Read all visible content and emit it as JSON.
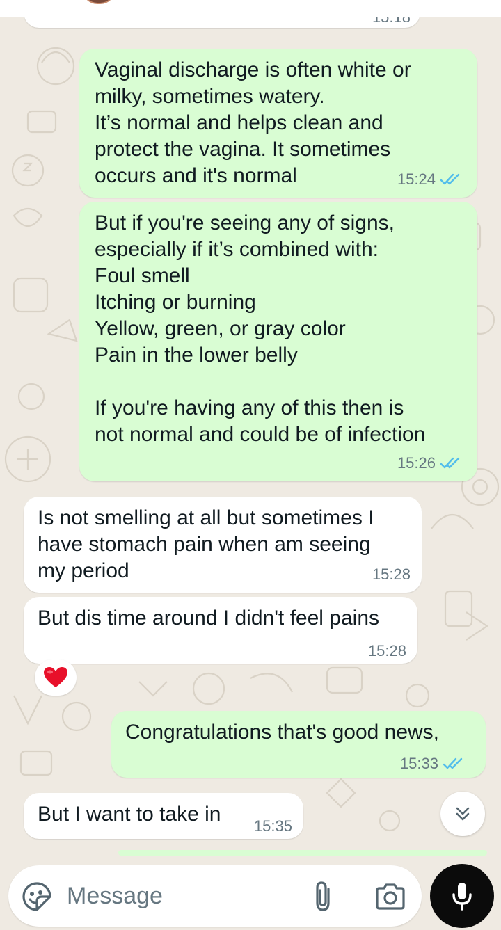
{
  "previous_message": {
    "time": "15:18"
  },
  "messages": [
    {
      "direction": "outgoing",
      "text": "Vaginal discharge is often white or\nmilky, sometimes watery.\nIt’s normal and helps clean and\nprotect the vagina. It sometimes\noccurs and it's normal",
      "time": "15:24",
      "status": "read"
    },
    {
      "direction": "outgoing",
      "text": "But if you're seeing any of signs,\nespecially if it’s combined with:\nFoul smell\nItching or burning\nYellow, green, or gray color\nPain in the lower belly\n\nIf you're having any of this then is\nnot normal and could be of infection",
      "time": "15:26",
      "status": "read"
    },
    {
      "direction": "incoming",
      "text": "Is not smelling at all but sometimes I\nhave stomach pain when am seeing\nmy period",
      "time": "15:28"
    },
    {
      "direction": "incoming",
      "text": "But dis time around I didn't feel pains",
      "time": "15:28"
    },
    {
      "direction": "outgoing",
      "text": "Congratulations that's good news,",
      "time": "15:33",
      "status": "read"
    },
    {
      "direction": "incoming",
      "text": "But I want to take in",
      "time": "15:35"
    }
  ],
  "reaction": {
    "emoji": "heart",
    "color": "#e8102a"
  },
  "composer": {
    "placeholder": "Message"
  },
  "icons": {
    "emoji": "sticker-smiley-icon",
    "attach": "paperclip-icon",
    "camera": "camera-icon",
    "mic": "microphone-icon",
    "scroll": "double-chevron-down-icon",
    "read_receipt": "double-check-icon"
  },
  "colors": {
    "outgoing_bubble": "#d9fdd3",
    "incoming_bubble": "#ffffff",
    "background": "#efeae2",
    "read_tick": "#53bdeb",
    "timestamp": "#667781",
    "mic_button": "#0b0b0b"
  }
}
